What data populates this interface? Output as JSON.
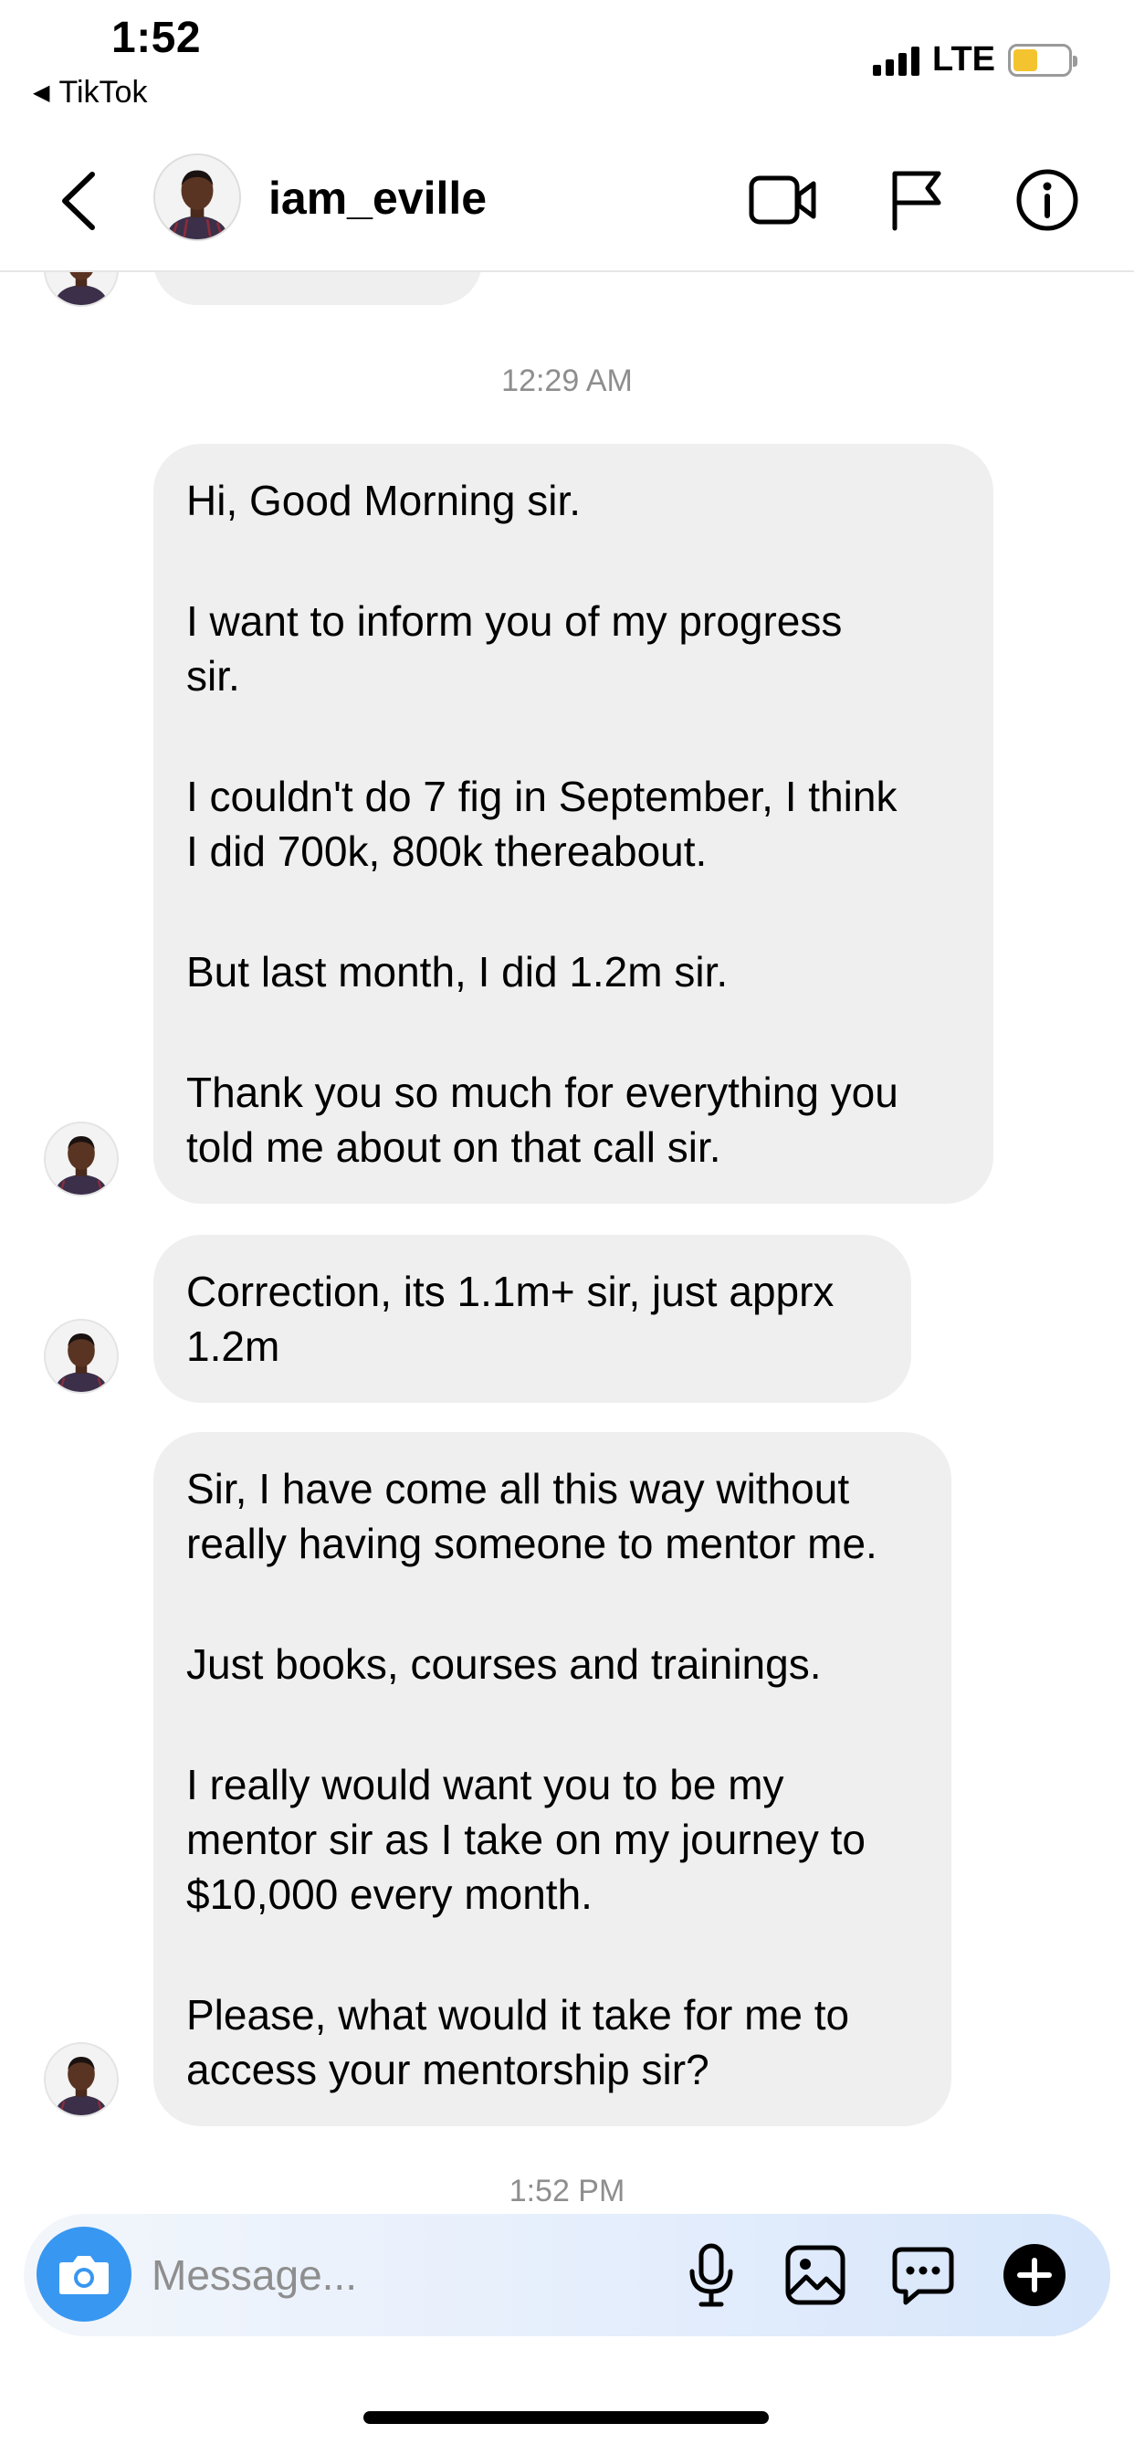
{
  "status_bar": {
    "time": "1:52",
    "back_app": "TikTok",
    "network": "LTE",
    "battery_level": 0.3,
    "battery_color": "#f4c430"
  },
  "header": {
    "username": "iam_eville",
    "icons": [
      "chevron-left-icon",
      "video-call-icon",
      "flag-icon",
      "info-icon"
    ]
  },
  "chat": {
    "timestamp_1": "12:29 AM",
    "messages": [
      {
        "paragraphs": [
          "Hi, Good Morning sir.",
          "I want to inform you of my progress\nsir.",
          "I couldn't do 7 fig in September, I think\nI did 700k, 800k thereabout.",
          "But last month, I did 1.2m sir.",
          "Thank you so much for everything you\ntold me about on that call sir."
        ]
      },
      {
        "paragraphs": [
          "Correction, its 1.1m+ sir, just apprx\n1.2m"
        ]
      },
      {
        "paragraphs": [
          "Sir, I have come all this way without\nreally having someone to mentor me.",
          "Just books, courses and trainings.",
          "I really would want you to be my\nmentor sir as I take on my journey to\n$10,000 every month.",
          "Please, what would it take for me to\naccess your mentorship sir?"
        ]
      }
    ],
    "timestamp_2": "1:52 PM"
  },
  "composer": {
    "placeholder": "Message...",
    "icons": [
      "camera-icon",
      "microphone-icon",
      "image-icon",
      "sticker-icon",
      "plus-icon"
    ],
    "camera_color": "#3897f0"
  }
}
